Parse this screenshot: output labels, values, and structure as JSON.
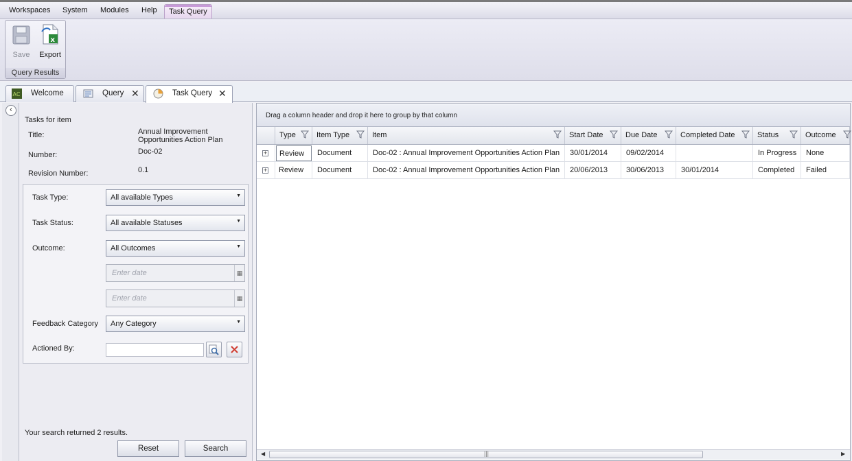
{
  "menu": {
    "items": [
      "Workspaces",
      "System",
      "Modules",
      "Help"
    ],
    "active": "Task Query"
  },
  "ribbon": {
    "save_label": "Save",
    "export_label": "Export",
    "group_label": "Query Results"
  },
  "doc_tabs": {
    "welcome": "Welcome",
    "query": "Query",
    "task_query": "Task Query",
    "close_glyph": "✕"
  },
  "left": {
    "heading": "Tasks for item",
    "title_label": "Title:",
    "title_value_line1": "Annual Improvement",
    "title_value_line2": "Opportunities Action Plan",
    "number_label": "Number:",
    "number_value": "Doc-02",
    "revision_label": "Revision Number:",
    "revision_value": "0.1",
    "task_type_label": "Task Type:",
    "task_type_value": "All available Types",
    "task_status_label": "Task Status:",
    "task_status_value": "All available Statuses",
    "outcome_label": "Outcome:",
    "outcome_value": "All Outcomes",
    "date_placeholder": "Enter date",
    "feedback_label": "Feedback Category",
    "feedback_value": "Any Category",
    "actioned_label": "Actioned By:",
    "actioned_value": "",
    "result_text": "Your search returned 2 results.",
    "reset_label": "Reset",
    "search_label": "Search"
  },
  "grid": {
    "group_hint": "Drag a column header and drop it here to group by that column",
    "columns": [
      "Type",
      "Item Type",
      "Item",
      "Start Date",
      "Due Date",
      "Completed Date",
      "Status",
      "Outcome"
    ],
    "rows": [
      [
        "Review",
        "Document",
        "Doc-02 : Annual Improvement Opportunities Action Plan",
        "30/01/2014",
        "09/02/2014",
        "",
        "In Progress",
        "None"
      ],
      [
        "Review",
        "Document",
        "Doc-02 : Annual Improvement Opportunities Action Plan",
        "20/06/2013",
        "30/06/2013",
        "30/01/2014",
        "Completed",
        "Failed"
      ]
    ]
  }
}
